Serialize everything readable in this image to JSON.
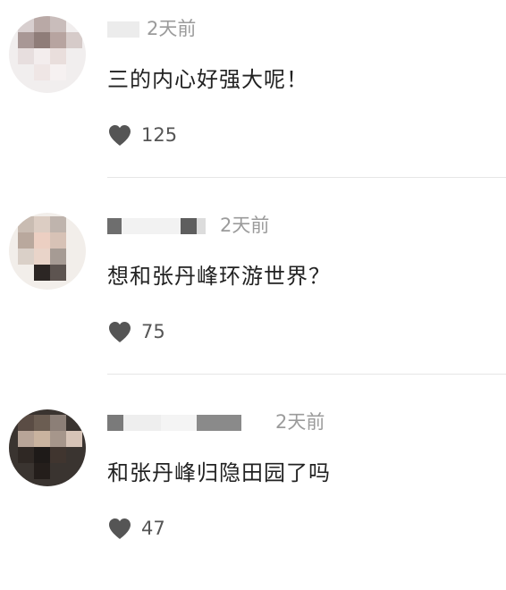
{
  "comments": [
    {
      "username": "",
      "time": "2天前",
      "text": "三的内心好强大呢！",
      "likes": "125"
    },
    {
      "username": "",
      "time": "2天前",
      "text": "想和张丹峰环游世界？",
      "likes": "75"
    },
    {
      "username": "",
      "time": "2天前",
      "text": "和张丹峰归隐田园了吗",
      "likes": "47"
    }
  ],
  "colors": {
    "time": "#9b9b9b",
    "text": "#222222",
    "like_icon": "#555555",
    "divider": "#e6e6e6"
  },
  "icons": {
    "like": "heart-icon"
  }
}
